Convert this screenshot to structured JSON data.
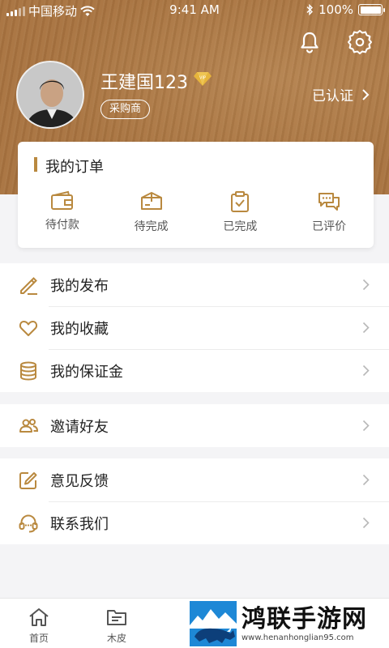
{
  "status_bar": {
    "carrier": "中国移动",
    "time": "9:41 AM",
    "battery": "100%",
    "battery_level": 1.0
  },
  "header": {
    "notification_icon": "bell-icon",
    "settings_icon": "gear-icon",
    "user_name": "王建国123",
    "vip_icon": "vip-diamond-icon",
    "role": "采购商",
    "verified_label": "已认证"
  },
  "orders": {
    "title": "我的订单",
    "items": [
      {
        "label": "待付款",
        "icon": "wallet-icon"
      },
      {
        "label": "待完成",
        "icon": "package-icon"
      },
      {
        "label": "已完成",
        "icon": "clipboard-check-icon"
      },
      {
        "label": "已评价",
        "icon": "chat-bubbles-icon"
      }
    ]
  },
  "menu_groups": [
    {
      "items": [
        {
          "label": "我的发布",
          "icon": "pencil-icon"
        },
        {
          "label": "我的收藏",
          "icon": "heart-icon"
        },
        {
          "label": "我的保证金",
          "icon": "database-icon"
        }
      ]
    },
    {
      "items": [
        {
          "label": "邀请好友",
          "icon": "users-icon"
        }
      ]
    },
    {
      "items": [
        {
          "label": "意见反馈",
          "icon": "edit-square-icon"
        },
        {
          "label": "联系我们",
          "icon": "headset-icon"
        }
      ]
    }
  ],
  "tabbar": {
    "items": [
      {
        "label": "首页",
        "icon": "home-icon"
      },
      {
        "label": "木皮",
        "icon": "folder-icon"
      }
    ]
  },
  "watermark": {
    "title": "鸿联手游网",
    "url": "www.henanhonglian95.com"
  },
  "colors": {
    "accent": "#b9893f",
    "header_brown": "#a8733f"
  }
}
